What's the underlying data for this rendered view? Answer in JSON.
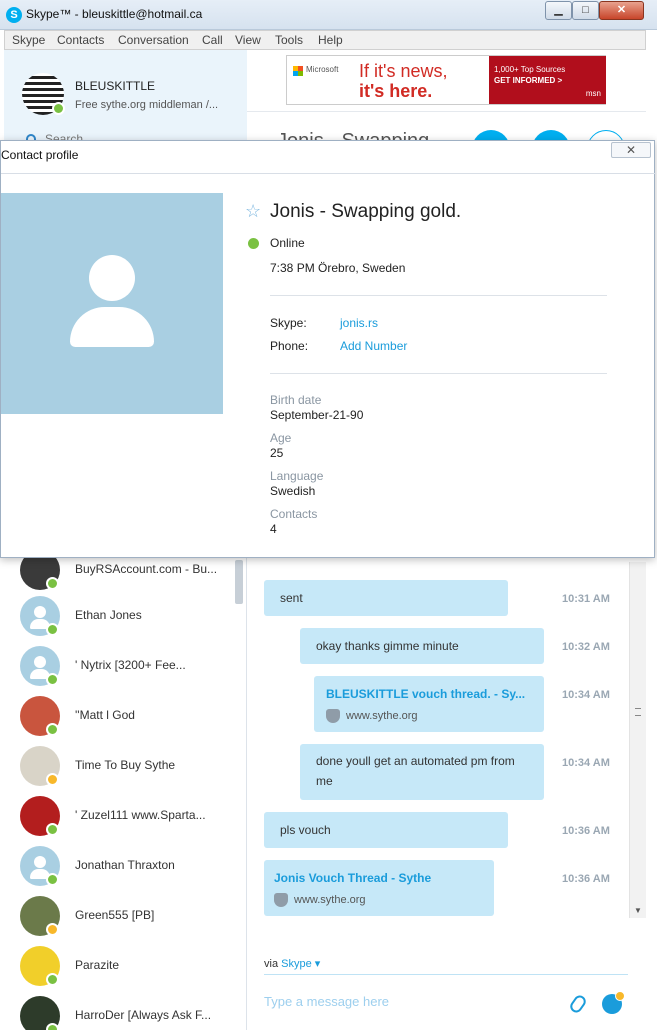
{
  "window": {
    "title": "Skype™ - bleuskittle@hotmail.ca",
    "icon": "skype-icon",
    "controls": {
      "minimize": "▁",
      "maximize": "□",
      "close": "✕"
    }
  },
  "menu": [
    "Skype",
    "Contacts",
    "Conversation",
    "Call",
    "View",
    "Tools",
    "Help"
  ],
  "me": {
    "name": "BLEUSKITTLE",
    "mood": "Free sythe.org middleman /...",
    "status_color": "#7ac142"
  },
  "search": {
    "label": "Search"
  },
  "contacts": [
    {
      "name": "BuyRSAccount.com - Bu...",
      "status": "online"
    },
    {
      "name": "Ethan Jones",
      "status": "online"
    },
    {
      "name": "'      Nytrix [3200+ Fee...",
      "status": "online"
    },
    {
      "name": "''Matt l God",
      "status": "online"
    },
    {
      "name": "Time To Buy Sythe",
      "status": "away"
    },
    {
      "name": "' Zuzel111   www.Sparta...",
      "status": "online"
    },
    {
      "name": "Jonathan Thraxton",
      "status": "online"
    },
    {
      "name": "Green555 [PB]",
      "status": "away"
    },
    {
      "name": "Parazite",
      "status": "online"
    },
    {
      "name": "HarroDer [Always Ask F...",
      "status": "online"
    }
  ],
  "ad": {
    "brand": "Microsoft",
    "headline_1": "If it's news,",
    "headline_2": "it's here.",
    "cta_1": "1,000+ Top Sources",
    "cta_2": "GET INFORMED >",
    "cta_brand": "msn"
  },
  "conversation": {
    "ghost_title": "Jonis - Swapping...",
    "messages": [
      {
        "text": "sent",
        "time": "10:31 AM",
        "kind": "text"
      },
      {
        "text": "okay thanks gimme minute",
        "time": "10:32 AM",
        "kind": "text"
      },
      {
        "title": "BLEUSKITTLE vouch thread. - Sy...",
        "url": "www.sythe.org",
        "time": "10:34 AM",
        "kind": "link"
      },
      {
        "text": "done youll get an automated pm from me",
        "time": "10:34 AM",
        "kind": "text"
      },
      {
        "text": "pls vouch",
        "time": "10:36 AM",
        "kind": "text"
      },
      {
        "title": "Jonis Vouch Thread - Sythe",
        "url": "www.sythe.org",
        "time": "10:36 AM",
        "kind": "link"
      }
    ],
    "via_prefix": "via",
    "via_link": "Skype ▾",
    "compose_placeholder": "Type a message here"
  },
  "profile_dialog": {
    "title": "Contact profile",
    "close": "✕",
    "name": "Jonis - Swapping gold.",
    "status": "Online",
    "local_time": "7:38 PM Örebro, Sweden",
    "skype_label": "Skype:",
    "skype_value": "jonis.rs",
    "phone_label": "Phone:",
    "phone_value": "Add Number",
    "fields": [
      {
        "label": "Birth date",
        "value": "September-21-90"
      },
      {
        "label": "Age",
        "value": "25"
      },
      {
        "label": "Language",
        "value": "Swedish"
      },
      {
        "label": "Contacts",
        "value": "4"
      }
    ]
  }
}
